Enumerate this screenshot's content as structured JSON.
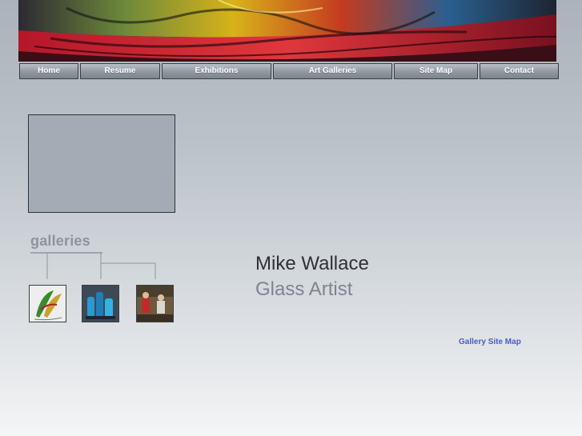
{
  "nav": {
    "items": [
      {
        "label": "Home"
      },
      {
        "label": "Resume"
      },
      {
        "label": "Exhibitions"
      },
      {
        "label": "Art Galleries"
      },
      {
        "label": "Site Map"
      },
      {
        "label": "Contact"
      }
    ]
  },
  "galleries": {
    "title": "galleries",
    "thumbnails": [
      "glass-sculpture-thumbnail",
      "blue-vases-thumbnail",
      "studio-photo-thumbnail"
    ]
  },
  "artist": {
    "name": "Mike Wallace",
    "role": "Glass Artist"
  },
  "links": {
    "gallery_site_map": "Gallery Site Map"
  },
  "colors": {
    "nav_button": "#8f979f",
    "link": "#4b5bc4"
  }
}
